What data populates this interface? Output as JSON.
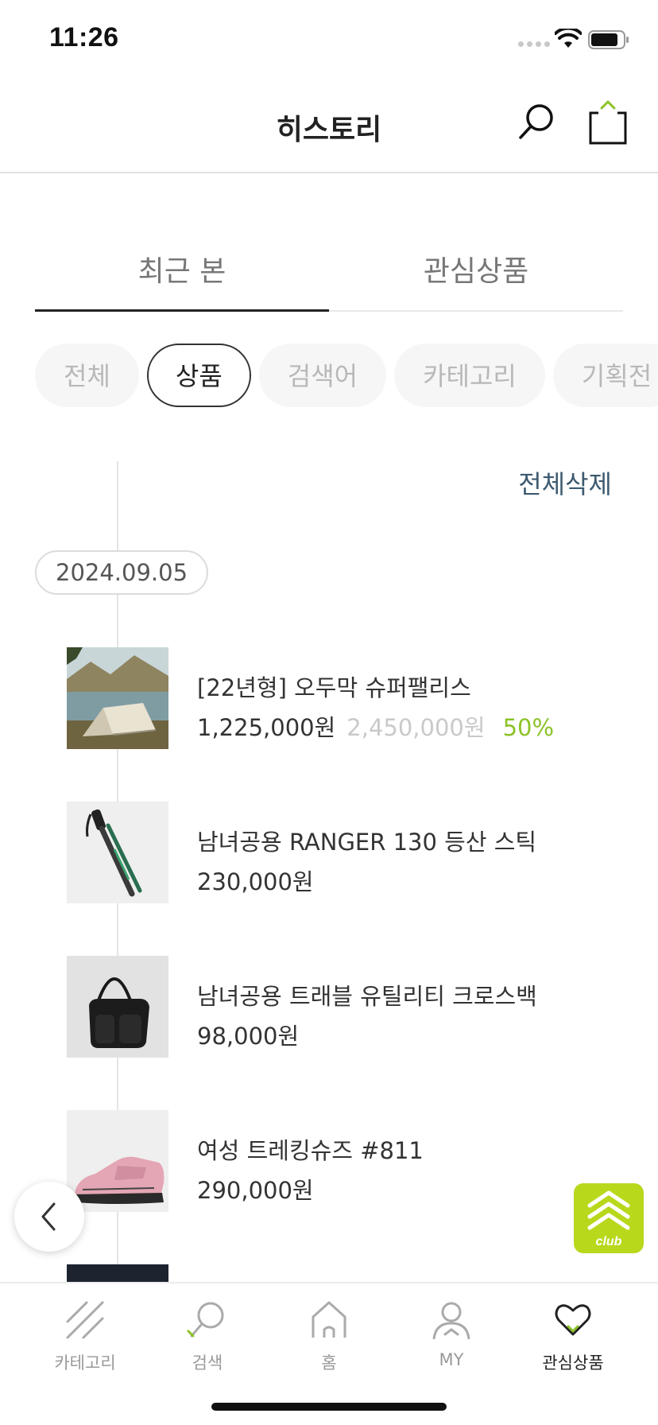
{
  "status_bar": {
    "time": "11:26"
  },
  "header": {
    "title": "히스토리"
  },
  "tabs": [
    {
      "label": "최근 본",
      "active": true
    },
    {
      "label": "관심상품",
      "active": false
    }
  ],
  "chips": [
    {
      "label": "전체",
      "active": false
    },
    {
      "label": "상품",
      "active": true
    },
    {
      "label": "검색어",
      "active": false
    },
    {
      "label": "카테고리",
      "active": false
    },
    {
      "label": "기획전",
      "active": false
    }
  ],
  "history": {
    "delete_all_label": "전체삭제",
    "date": "2024.09.05",
    "items": [
      {
        "name": "[22년형] 오두막 슈퍼팰리스",
        "price": "1,225,000원",
        "original_price": "2,450,000원",
        "discount": "50%",
        "thumb_icon": "tent-photo"
      },
      {
        "name": "남녀공용 RANGER 130 등산 스틱",
        "price": "230,000원",
        "thumb_icon": "trekking-pole-photo"
      },
      {
        "name": "남녀공용 트래블 유틸리티 크로스백",
        "price": "98,000원",
        "thumb_icon": "crossbag-photo"
      },
      {
        "name": "여성 트레킹슈즈 #811",
        "price": "290,000원",
        "thumb_icon": "shoe-photo"
      }
    ]
  },
  "bottom_nav": [
    {
      "label": "카테고리",
      "icon": "category-icon",
      "active": false
    },
    {
      "label": "검색",
      "icon": "search-icon",
      "active": false
    },
    {
      "label": "홈",
      "icon": "home-icon",
      "active": false
    },
    {
      "label": "MY",
      "icon": "person-icon",
      "active": false
    },
    {
      "label": "관심상품",
      "icon": "heart-icon",
      "active": true
    }
  ],
  "colors": {
    "accent_green": "#8cc228",
    "club_badge": "#b8d81c",
    "delete_link": "#3d5a70"
  },
  "club_badge_text": "club"
}
